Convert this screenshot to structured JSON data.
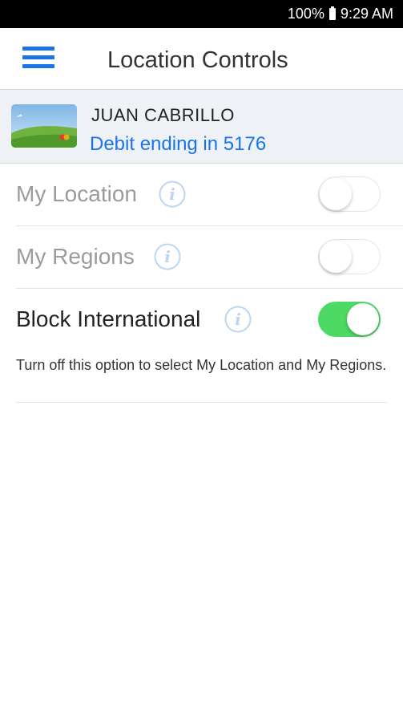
{
  "status_bar": {
    "battery": "100%",
    "time": "9:29 AM"
  },
  "app_bar": {
    "title": "Location Controls"
  },
  "card": {
    "holder_name": "JUAN CABRILLO",
    "description": "Debit ending in 5176"
  },
  "settings": [
    {
      "label": "My Location",
      "enabled": false,
      "toggle_on": false
    },
    {
      "label": "My Regions",
      "enabled": false,
      "toggle_on": false
    },
    {
      "label": "Block International",
      "enabled": true,
      "toggle_on": true
    }
  ],
  "note": "Turn off this option to select My Location and My Regions.",
  "colors": {
    "accent": "#1a73e8",
    "toggle_on": "#4cd964",
    "card_bg": "#eef2f6",
    "disabled_text": "#9b9b9b"
  }
}
